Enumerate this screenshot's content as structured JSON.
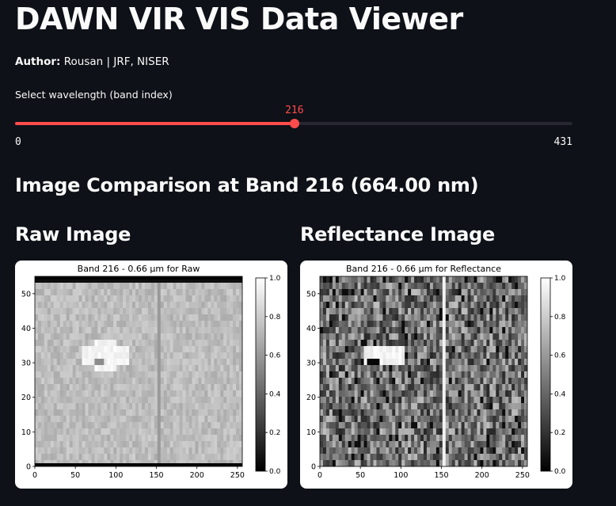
{
  "app": {
    "title": "DAWN VIR VIS Data Viewer",
    "author_label": "Author:",
    "author_value": "Rousan | JRF, NISER"
  },
  "slider": {
    "label": "Select wavelength (band index)",
    "value": 216,
    "min": 0,
    "max": 431,
    "min_label": "0",
    "max_label": "431",
    "value_label": "216",
    "accent_color": "#ff4b4b"
  },
  "comparison": {
    "heading": "Image Comparison at Band 216 (664.00 nm)"
  },
  "panels": [
    {
      "heading": "Raw Image",
      "plot_title": "Band 216 - 0.66 µm for Raw",
      "x_ticks": [
        "0",
        "50",
        "100",
        "150",
        "200",
        "250"
      ],
      "y_ticks": [
        "0",
        "10",
        "20",
        "30",
        "40",
        "50"
      ],
      "colorbar_ticks": [
        "0.0",
        "0.2",
        "0.4",
        "0.6",
        "0.8",
        "1.0"
      ]
    },
    {
      "heading": "Reflectance Image",
      "plot_title": "Band 216 - 0.66 µm for Reflectance",
      "x_ticks": [
        "0",
        "50",
        "100",
        "150",
        "200",
        "250"
      ],
      "y_ticks": [
        "0",
        "10",
        "20",
        "30",
        "40",
        "50"
      ],
      "colorbar_ticks": [
        "0.0",
        "0.2",
        "0.4",
        "0.6",
        "0.8",
        "1.0"
      ]
    }
  ]
}
